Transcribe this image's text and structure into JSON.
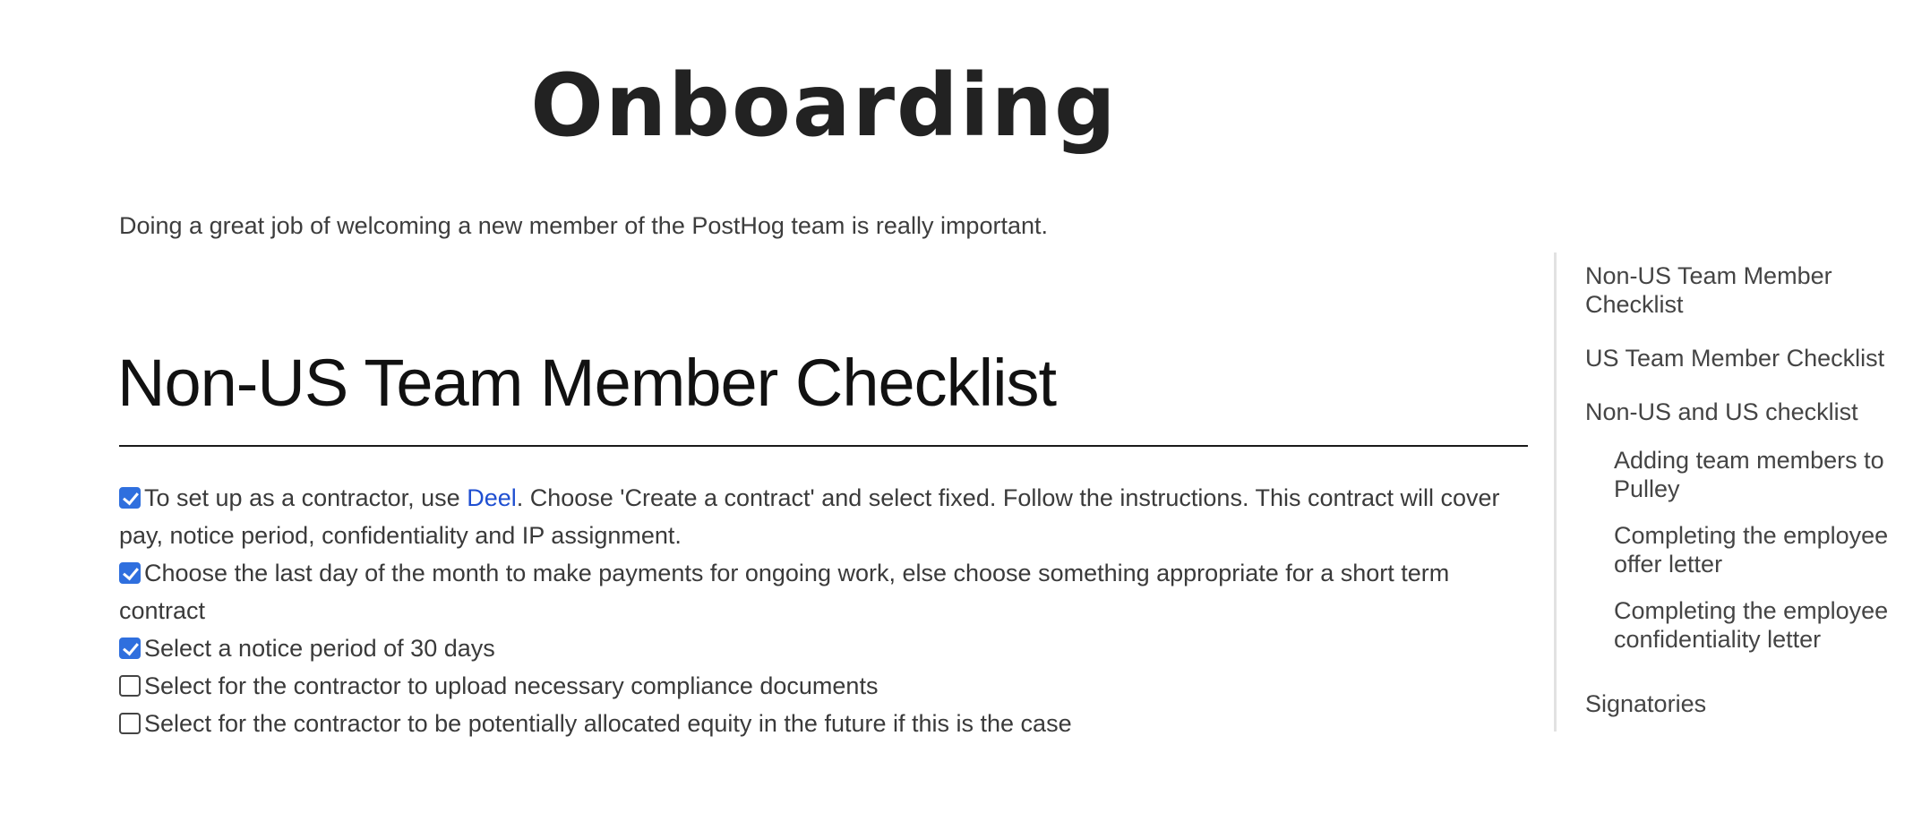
{
  "page": {
    "title": "Onboarding",
    "intro": "Doing a great job of welcoming a new member of the PostHog team is really important."
  },
  "section": {
    "heading": "Non-US Team Member Checklist",
    "checklist": [
      {
        "checked": true,
        "text_before": "To set up as a contractor, use ",
        "link": "Deel",
        "text_after": ". Choose 'Create a contract' and select fixed. Follow the instructions. This contract will cover pay, notice period, confidentiality and IP assignment."
      },
      {
        "checked": true,
        "text": "Choose the last day of the month to make payments for ongoing work, else choose something appropriate for a short term contract"
      },
      {
        "checked": true,
        "text": "Select a notice period of 30 days"
      },
      {
        "checked": false,
        "text": "Select for the contractor to upload necessary compliance documents"
      },
      {
        "checked": false,
        "text": "Select for the contractor to be potentially allocated equity in the future if this is the case"
      }
    ]
  },
  "toc": {
    "items": [
      {
        "label": "Non-US Team Member Checklist",
        "level": 1
      },
      {
        "label": "US Team Member Checklist",
        "level": 1
      },
      {
        "label": "Non-US and US checklist",
        "level": 1
      },
      {
        "label": "Adding team members to Pulley",
        "level": 2
      },
      {
        "label": "Completing the employee offer letter",
        "level": 2
      },
      {
        "label": "Completing the employee confidentiality letter",
        "level": 2
      },
      {
        "label": "Signatories",
        "level": 1
      }
    ]
  },
  "colors": {
    "checkbox_checked": "#2f6fde",
    "link": "#1f4fd1",
    "text": "#3a3a3a"
  },
  "icons": {
    "checked": "checkbox-checked-icon",
    "unchecked": "checkbox-unchecked-icon"
  }
}
